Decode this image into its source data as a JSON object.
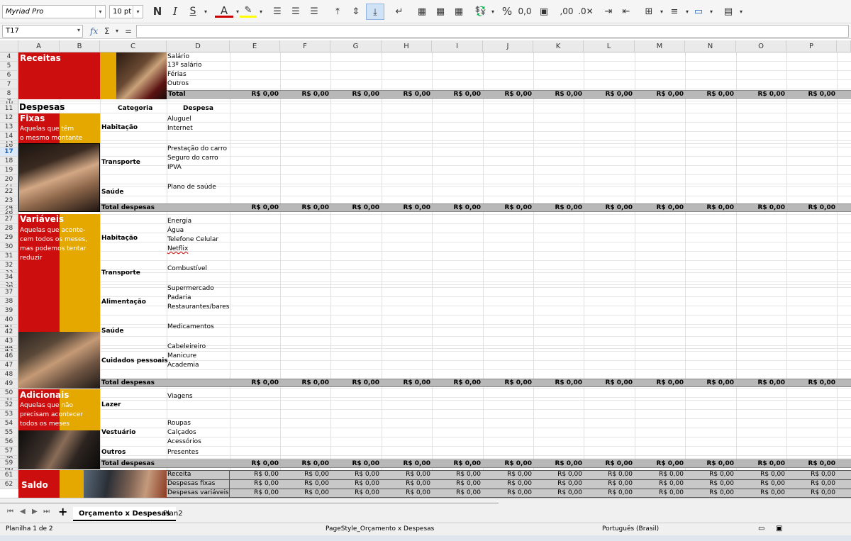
{
  "toolbar": {
    "font_name": "Myriad Pro",
    "font_size": "10 pt",
    "bold": "N",
    "italic": "I",
    "underline": "S",
    "percent": "%",
    "number_format": "0,0",
    "add_decimal": ",00"
  },
  "formula_bar": {
    "cell_ref": "T17",
    "fx": "fx",
    "sigma": "Σ",
    "equals": "="
  },
  "columns": [
    "A",
    "B",
    "C",
    "D",
    "E",
    "F",
    "G",
    "H",
    "I",
    "J",
    "K",
    "L",
    "M",
    "N",
    "O",
    "P"
  ],
  "rows": [
    "4",
    "5",
    "6",
    "7",
    "8",
    "9",
    "10",
    "11",
    "12",
    "13",
    "14",
    "15",
    "16",
    "17",
    "18",
    "19",
    "20",
    "21",
    "22",
    "23",
    "24",
    "25",
    "26",
    "27",
    "28",
    "29",
    "30",
    "31",
    "32",
    "33",
    "34",
    "35",
    "36",
    "37",
    "38",
    "39",
    "40",
    "41",
    "42",
    "43",
    "44",
    "45",
    "46",
    "47",
    "48",
    "49",
    "50",
    "51",
    "52",
    "53",
    "54",
    "55",
    "56",
    "57",
    "58",
    "59",
    "60",
    "61",
    "62"
  ],
  "selected_row": "17",
  "receitas": {
    "title": "Receitas",
    "items": [
      "Salário",
      "13º salário",
      "Férias",
      "Outros"
    ],
    "total_label": "Total"
  },
  "despesas_title": "Despesas",
  "headers": {
    "categoria": "Categoria",
    "despesa": "Despesa"
  },
  "fixas": {
    "title": "Fixas",
    "desc1": "Aquelas que têm",
    "desc2": "o mesmo montante",
    "cat_habitacao": "Habitação",
    "hab_items": [
      "Aluguel",
      "Internet"
    ],
    "cat_transporte": "Transporte",
    "trans_items": [
      "Prestação do carro",
      "Seguro do carro",
      "IPVA"
    ],
    "cat_saude": "Saúde",
    "saude_items": [
      "Plano de saúde"
    ],
    "total_label": "Total despesas"
  },
  "variaveis": {
    "title": "Variáveis",
    "desc1": "Aquelas que aconte-",
    "desc2": "cem todos os meses,",
    "desc3": "mas podemos tentar",
    "desc4": "reduzir",
    "cat_habitacao": "Habitação",
    "hab_items": [
      "Energia",
      "Água",
      "Telefone Celular",
      "Netflix"
    ],
    "cat_transporte": "Transporte",
    "trans_items": [
      "Combustível"
    ],
    "cat_alimentacao": "Alimentação",
    "alim_items": [
      "Supermercado",
      "Padaria",
      "Restaurantes/bares"
    ],
    "cat_saude": "Saúde",
    "saude_items": [
      "Medicamentos"
    ],
    "cat_cuidados": "Cuidados pessoais",
    "cuid_items": [
      "Cabeleireiro",
      "Manicure",
      "Academia"
    ],
    "total_label": "Total despesas"
  },
  "adicionais": {
    "title": "Adicionais",
    "desc1": "Aquelas que não",
    "desc2": "precisam acontecer",
    "desc3": "todos os meses",
    "cat_lazer": "Lazer",
    "lazer_items": [
      "Viagens"
    ],
    "cat_vestuario": "Vestuário",
    "vest_items": [
      "Roupas",
      "Calçados",
      "Acessórios"
    ],
    "cat_outros": "Outros",
    "outros_items": [
      "Presentes"
    ],
    "total_label": "Total despesas"
  },
  "saldo": {
    "title": "Saldo",
    "rows": [
      "Receita",
      "Despesas fixas",
      "Despesas variáveis"
    ]
  },
  "currency_value": "R$ 0,00",
  "sheet_tabs": {
    "add": "+",
    "tabs": [
      "Orçamento x Despesas",
      "Plan2"
    ],
    "active": "Orçamento x Despesas"
  },
  "status_bar": {
    "sheet_info": "Planilha 1 de 2",
    "page_style": "PageStyle_Orçamento x Despesas",
    "language": "Português (Brasil)"
  },
  "colors": {
    "red": "#cc0e0e",
    "gold": "#e4a800",
    "total_gray": "#b8b8b8",
    "selection": "#1565c0"
  }
}
